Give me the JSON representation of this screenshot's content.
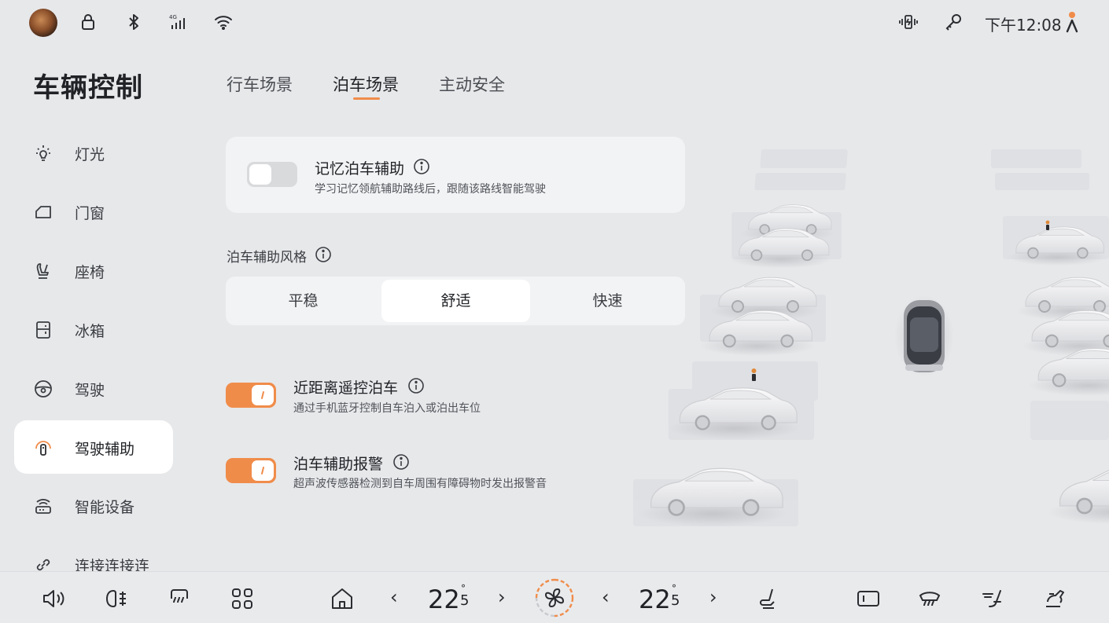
{
  "status_bar": {
    "icons": [
      "avatar",
      "lock-icon",
      "bluetooth-icon",
      "signal-4g-icon",
      "wifi-icon",
      "phone-vibrate-icon",
      "key-icon",
      "person-icon"
    ],
    "time": "下午12:08"
  },
  "page_title": "车辆控制",
  "tabs": [
    {
      "label": "行车场景",
      "active": false
    },
    {
      "label": "泊车场景",
      "active": true
    },
    {
      "label": "主动安全",
      "active": false
    }
  ],
  "sidebar": {
    "items": [
      {
        "label": "灯光",
        "icon": "light-icon",
        "active": false
      },
      {
        "label": "门窗",
        "icon": "door-icon",
        "active": false
      },
      {
        "label": "座椅",
        "icon": "seat-icon",
        "active": false
      },
      {
        "label": "冰箱",
        "icon": "fridge-icon",
        "active": false
      },
      {
        "label": "驾驶",
        "icon": "steering-wheel-icon",
        "active": false
      },
      {
        "label": "驾驶辅助",
        "icon": "driving-assist-icon",
        "active": true
      },
      {
        "label": "智能设备",
        "icon": "smart-device-icon",
        "active": false
      },
      {
        "label": "连接连接连",
        "icon": "link-icon",
        "active": false
      }
    ]
  },
  "memory_parking": {
    "title": "记忆泊车辅助",
    "description": "学习记忆领航辅助路线后，跟随该路线智能驾驶",
    "enabled": false
  },
  "parking_style": {
    "label": "泊车辅助风格",
    "options": [
      "平稳",
      "舒适",
      "快速"
    ],
    "selected": "舒适"
  },
  "remote_parking": {
    "title": "近距离遥控泊车",
    "description": "通过手机蓝牙控制自车泊入或泊出车位",
    "enabled": true
  },
  "parking_alert": {
    "title": "泊车辅助报警",
    "description": "超声波传感器检测到自车周围有障碍物时发出报警音",
    "enabled": true
  },
  "dock": {
    "left_temp": {
      "whole": "22",
      "decimal": "5",
      "unit": "°"
    },
    "right_temp": {
      "whole": "22",
      "decimal": "5",
      "unit": "°"
    },
    "chevron_left": "‹",
    "chevron_right": "›",
    "accent_color": "#f08c4a"
  },
  "colors": {
    "accent": "#f08c4a",
    "background": "#e7e8ea",
    "card": "#f2f3f4",
    "active_bg": "#ffffff"
  }
}
